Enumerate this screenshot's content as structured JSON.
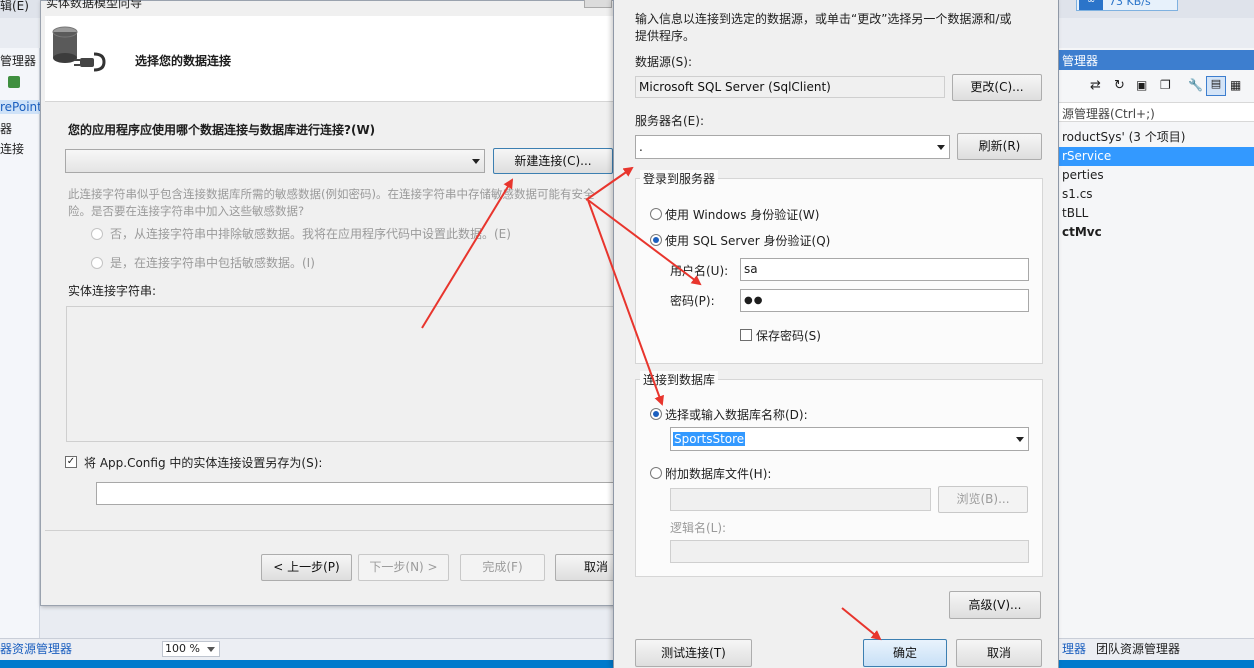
{
  "ide": {
    "menu_partial": "辑(E)",
    "left_panel": {
      "title": "管理器",
      "items": [
        "rePoint",
        "器",
        "连接"
      ]
    },
    "right_panel": {
      "title": "管理器",
      "search_placeholder": "源管理器(Ctrl+;)",
      "items": [
        {
          "text": "roductSys' (3 个项目)",
          "bold": false,
          "selected": false
        },
        {
          "text": "rService",
          "bold": false,
          "selected": true
        },
        {
          "text": "perties",
          "bold": false,
          "selected": false
        },
        {
          "text": "s1.cs",
          "bold": false,
          "selected": false
        },
        {
          "text": "tBLL",
          "bold": false,
          "selected": false
        },
        {
          "text": "ctMvc",
          "bold": true,
          "selected": false
        }
      ]
    },
    "bottom_tabs": {
      "left": "器资源管理器",
      "right_1": "理器",
      "right_2": "团队资源管理器"
    },
    "zoom": "100 %",
    "network_badge": "73 KB/s"
  },
  "wizard": {
    "title": "实体数据模型向导",
    "header": "选择您的数据连接",
    "question": "您的应用程序应使用哪个数据连接与数据库进行连接?(W)",
    "connection_value": "",
    "new_connection_button": "新建连接(C)...",
    "sensitive_note_line1": "此连接字符串似乎包含连接数据库所需的敏感数据(例如密码)。在连接字符串中存储敏感数据可能有安全",
    "sensitive_note_line2": "险。是否要在连接字符串中加入这些敏感数据?",
    "option_no": "否，从连接字符串中排除敏感数据。我将在应用程序代码中设置此数据。(E)",
    "option_yes": "是，在连接字符串中包括敏感数据。(I)",
    "entity_string_label": "实体连接字符串:",
    "save_config_label": "将 App.Config 中的实体连接设置另存为(S):",
    "save_config_checked": true,
    "save_config_value": "",
    "buttons": {
      "back": "< 上一步(P)",
      "next": "下一步(N) >",
      "finish": "完成(F)",
      "cancel": "取消"
    }
  },
  "connection_dialog": {
    "intro": "输入信息以连接到选定的数据源，或单击“更改”选择另一个数据源和/或提供程序。",
    "datasource_label": "数据源(S):",
    "datasource_value": "Microsoft SQL Server (SqlClient)",
    "change_button": "更改(C)...",
    "server_label": "服务器名(E):",
    "server_value": ".",
    "refresh_button": "刷新(R)",
    "login_group": "登录到服务器",
    "windows_auth": "使用 Windows 身份验证(W)",
    "sql_auth": "使用 SQL Server 身份验证(Q)",
    "auth_selected": "sql",
    "username_label": "用户名(U):",
    "username_value": "sa",
    "password_label": "密码(P):",
    "password_value": "●●",
    "save_password_label": "保存密码(S)",
    "save_password_checked": false,
    "db_group": "连接到数据库",
    "select_db_label": "选择或输入数据库名称(D):",
    "db_value": "SportsStore",
    "attach_label": "附加数据库文件(H):",
    "browse_button": "浏览(B)...",
    "logical_name_label": "逻辑名(L):",
    "advanced_button": "高级(V)...",
    "test_button": "测试连接(T)",
    "ok_button": "确定",
    "cancel_button": "取消"
  },
  "colors": {
    "annotation_arrow": "#e8352d",
    "selection": "#3399ff",
    "ide_accent": "#007acc"
  }
}
